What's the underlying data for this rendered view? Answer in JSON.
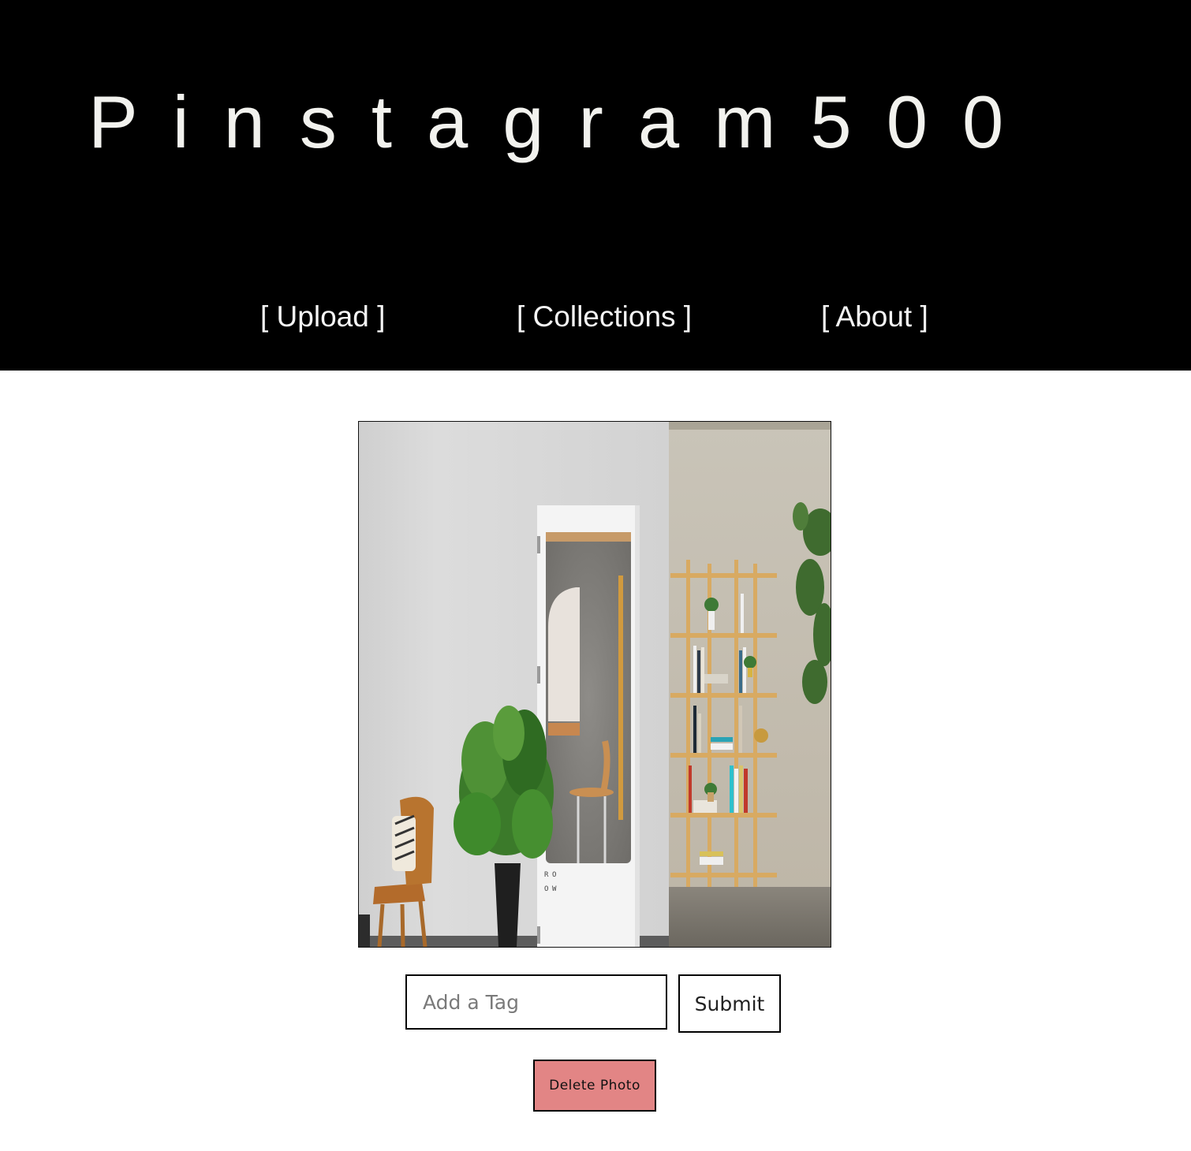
{
  "header": {
    "brand": "Pinstagram500",
    "nav": {
      "upload": "[ Upload ]",
      "collections": "[ Collections ]",
      "about": "[ About ]"
    },
    "background": "#000000",
    "text_color": "#f2f2ee"
  },
  "photo": {
    "box_letters": [
      "R",
      "O",
      "O",
      "W"
    ]
  },
  "tag_form": {
    "input_value": "",
    "input_placeholder": "Add a Tag",
    "submit_label": "Submit"
  },
  "delete_button": {
    "label": "Delete Photo",
    "color": "#e28585"
  }
}
